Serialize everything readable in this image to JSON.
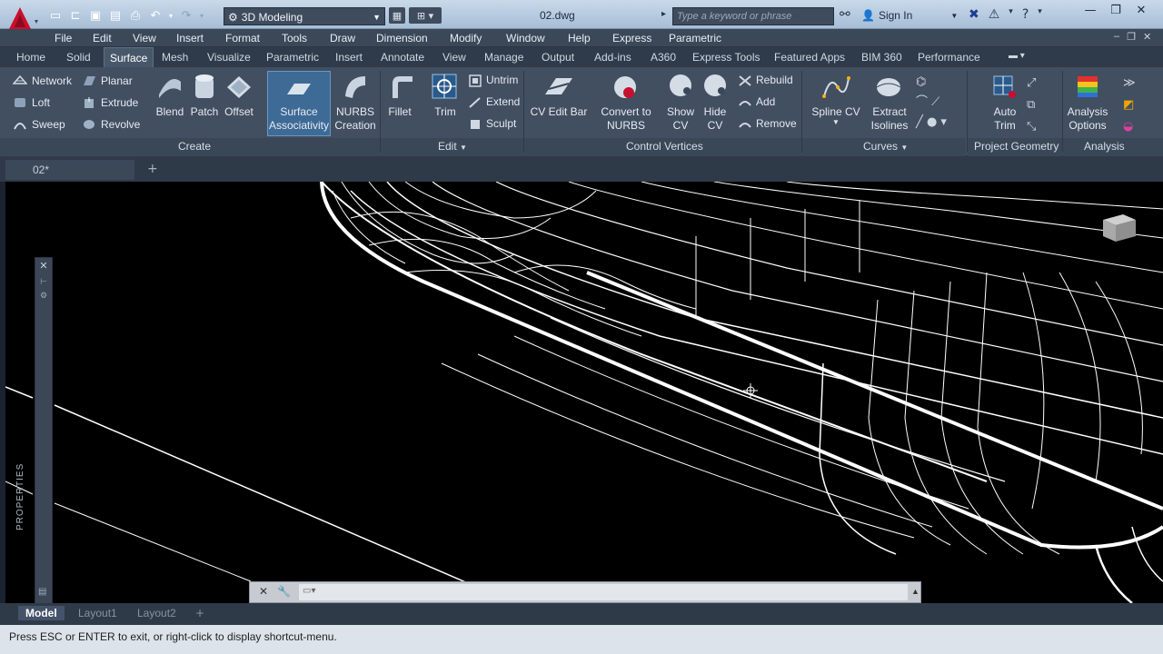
{
  "titlebar": {
    "workspace": "3D Modeling",
    "document": "02.dwg",
    "search_placeholder": "Type a keyword or phrase",
    "sign_in": "Sign In"
  },
  "menu": [
    "File",
    "Edit",
    "View",
    "Insert",
    "Format",
    "Tools",
    "Draw",
    "Dimension",
    "Modify",
    "Window",
    "Help",
    "Express",
    "Parametric"
  ],
  "ribbon_tabs": [
    "Home",
    "Solid",
    "Surface",
    "Mesh",
    "Visualize",
    "Parametric",
    "Insert",
    "Annotate",
    "View",
    "Manage",
    "Output",
    "Add-ins",
    "A360",
    "Express Tools",
    "Featured Apps",
    "BIM 360",
    "Performance"
  ],
  "ribbon_active_tab": "Surface",
  "ribbon": {
    "create": {
      "title": "Create",
      "small": [
        "Network",
        "Loft",
        "Sweep",
        "Planar",
        "Extrude",
        "Revolve"
      ],
      "blend": "Blend",
      "patch": "Patch",
      "offset": "Offset",
      "surface_assoc_1": "Surface",
      "surface_assoc_2": "Associativity",
      "nurbs_1": "NURBS",
      "nurbs_2": "Creation"
    },
    "edit": {
      "title": "Edit",
      "fillet": "Fillet",
      "trim": "Trim",
      "untrim": "Untrim",
      "extend": "Extend",
      "sculpt": "Sculpt"
    },
    "cv": {
      "title": "Control Vertices",
      "cv_edit_bar": "CV Edit Bar",
      "convert_1": "Convert to",
      "convert_2": "NURBS",
      "show_1": "Show",
      "show_2": "CV",
      "hide_1": "Hide",
      "hide_2": "CV",
      "rebuild": "Rebuild",
      "add": "Add",
      "remove": "Remove"
    },
    "curves": {
      "title": "Curves",
      "spline_cv": "Spline CV",
      "extract_1": "Extract",
      "extract_2": "Isolines"
    },
    "project": {
      "title": "Project Geometry",
      "auto_1": "Auto",
      "auto_2": "Trim"
    },
    "analysis": {
      "title": "Analysis",
      "opt_1": "Analysis",
      "opt_2": "Options"
    }
  },
  "doc_tab": "02*",
  "properties_label": "PROPERTIES",
  "layout_tabs": [
    "Model",
    "Layout1",
    "Layout2"
  ],
  "status": "Press ESC or ENTER to exit, or right-click to display shortcut-menu.",
  "colors": {
    "accent": "#3e6a96",
    "logo": "#c8102e",
    "viewport": "#000000"
  }
}
